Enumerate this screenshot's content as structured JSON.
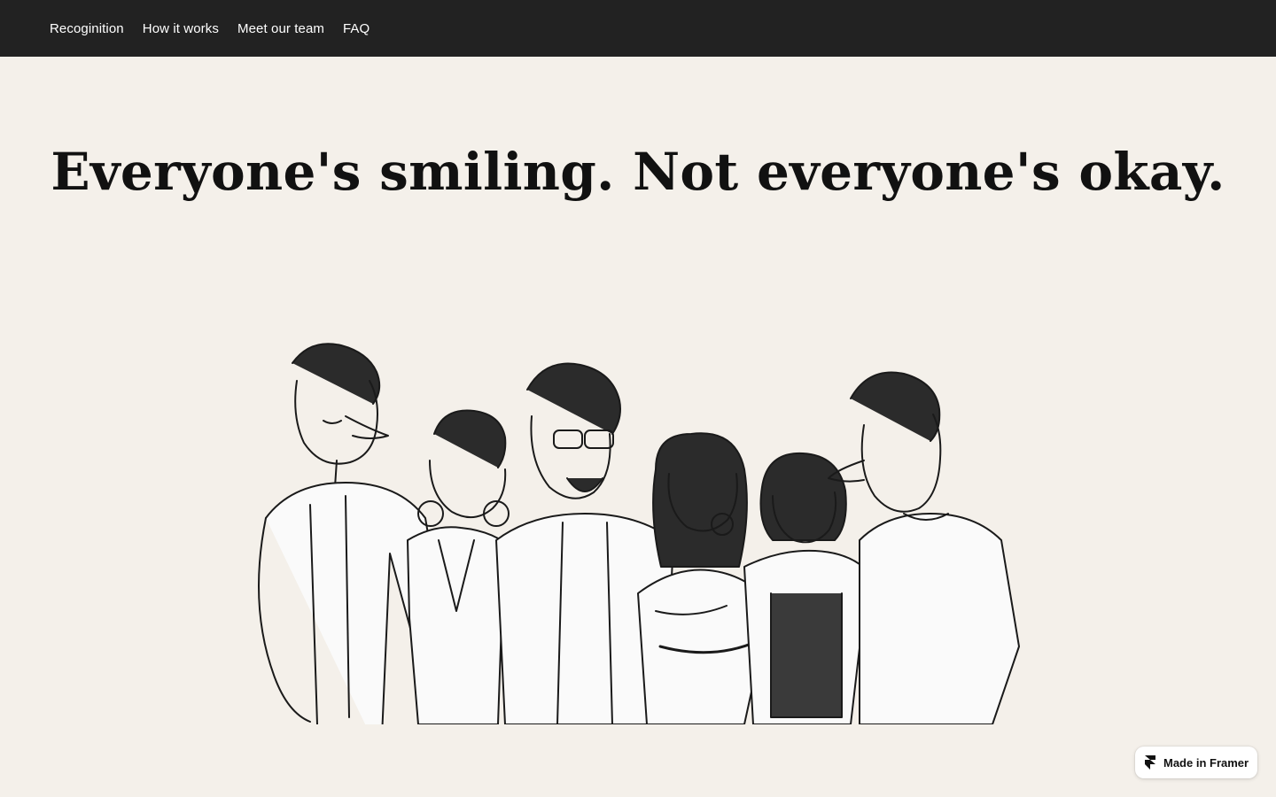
{
  "nav": {
    "items": [
      {
        "label": "Recoginition"
      },
      {
        "label": "How it works"
      },
      {
        "label": "Meet our team"
      },
      {
        "label": "FAQ"
      }
    ]
  },
  "hero": {
    "title": "Everyone's smiling. Not everyone's okay."
  },
  "illustration": {
    "icon": "group-of-friends-sketch"
  },
  "badge": {
    "label": "Made in Framer",
    "icon": "framer-logo-icon"
  },
  "colors": {
    "topbar": "#222222",
    "background": "#f4f0ea",
    "text": "#111111"
  }
}
